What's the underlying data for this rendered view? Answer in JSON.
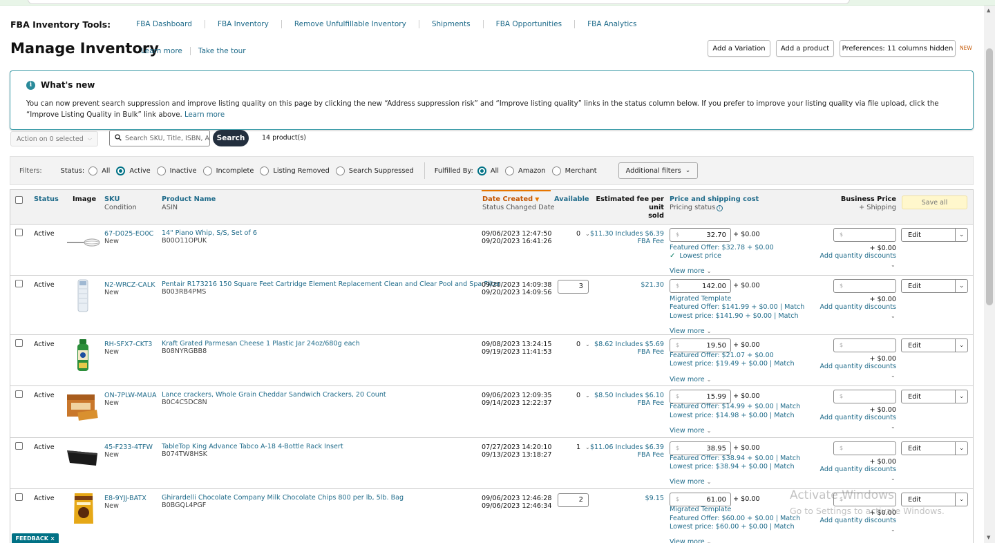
{
  "tools": {
    "label": "FBA Inventory Tools:",
    "links": [
      "FBA Dashboard",
      "FBA Inventory",
      "Remove Unfulfillable Inventory",
      "Shipments",
      "FBA Opportunities",
      "FBA Analytics"
    ]
  },
  "page": {
    "title": "Manage Inventory",
    "learn_more": "Learn more",
    "take_tour": "Take the tour",
    "add_variation": "Add a Variation",
    "add_product": "Add a product",
    "preferences": "Preferences: 11 columns hidden",
    "new_tag": "NEW"
  },
  "whats_new": {
    "title": "What's new",
    "body": "You can now prevent search suppression and improve listing quality on this page by clicking the new “Address suppression risk” and “Improve listing quality” links in the status column below. If you prefer to improve your listing quality via file upload, click the “Improve Listing Quality in Bulk” link above.",
    "learn_more": "Learn more"
  },
  "toolbar": {
    "action_select": "Action on 0 selected",
    "search_placeholder": "Search SKU, Title, ISBN, A",
    "search_button": "Search",
    "product_count": "14 product(s)"
  },
  "filters": {
    "label": "Filters:",
    "status_label": "Status:",
    "status_options": [
      "All",
      "Active",
      "Inactive",
      "Incomplete",
      "Listing Removed",
      "Search Suppressed"
    ],
    "status_selected": "Active",
    "fulfilled_label": "Fulfilled By:",
    "fulfilled_options": [
      "All",
      "Amazon",
      "Merchant"
    ],
    "fulfilled_selected": "All",
    "additional": "Additional filters"
  },
  "table": {
    "headers": {
      "status": "Status",
      "image": "Image",
      "sku": "SKU",
      "sku_sub": "Condition",
      "product": "Product Name",
      "product_sub": "ASIN",
      "date": "Date Created",
      "date_sub": "Status Changed Date",
      "available": "Available",
      "fee": "Estimated fee per unit",
      "fee_sub": "sold",
      "price": "Price and shipping cost",
      "price_sub": "Pricing status",
      "business": "Business Price",
      "business_sub": "+ Shipping",
      "save_all": "Save all"
    },
    "common": {
      "plus_zero": "+ $0.00",
      "view_more": "View more",
      "add_qty": "Add quantity discounts",
      "edit": "Edit",
      "dollar": "$"
    },
    "rows": [
      {
        "status": "Active",
        "sku": "67-D025-EO0C",
        "condition": "New",
        "name": "14\" Piano Whip, S/S, Set of 6",
        "asin": "B00O11OPUK",
        "created": "09/06/2023 12:47:50",
        "changed": "09/20/2023 16:41:26",
        "available": "0",
        "fee1": "$11.30 Includes $6.39",
        "fee2": "FBA Fee",
        "price": "32.70",
        "line1": "Featured Offer: $32.78 + $0.00",
        "line2": "Lowest price",
        "line3": ""
      },
      {
        "status": "Active",
        "sku": "N2-WRCZ-CALK",
        "condition": "New",
        "name": "Pentair R173216 150 Square Feet Cartridge Element Replacement Clean and Clear Pool and Spa Filter",
        "asin": "B003RB4PMS",
        "created": "09/20/2023 14:09:38",
        "changed": "09/20/2023 14:09:56",
        "available": "3",
        "fee1": "$21.30",
        "fee2": "",
        "price": "142.00",
        "line1": "Migrated Template",
        "line2": "Featured Offer: $141.99 + $0.00 | Match",
        "line3": "Lowest price: $141.90 + $0.00 | Match"
      },
      {
        "status": "Active",
        "sku": "RH-SFX7-CKT3",
        "condition": "New",
        "name": "Kraft Grated Parmesan Cheese 1 Plastic Jar 24oz/680g each",
        "asin": "B08NYRGBB8",
        "created": "09/08/2023 13:24:15",
        "changed": "09/19/2023 11:41:53",
        "available": "0",
        "fee1": "$8.62 Includes $5.69",
        "fee2": "FBA Fee",
        "price": "19.50",
        "line1": "Featured Offer: $21.07 + $0.00",
        "line2": "Lowest price: $19.49 + $0.00 | Match",
        "line3": ""
      },
      {
        "status": "Active",
        "sku": "ON-7PLW-MAUA",
        "condition": "New",
        "name": "Lance crackers, Whole Grain Cheddar Sandwich Crackers, 20 Count",
        "asin": "B0C4C5DC8N",
        "created": "09/06/2023 12:09:35",
        "changed": "09/14/2023 12:22:37",
        "available": "0",
        "fee1": "$8.50 Includes $6.10",
        "fee2": "FBA Fee",
        "price": "15.99",
        "line1": "Featured Offer: $14.99 + $0.00 | Match",
        "line2": "Lowest price: $14.98 + $0.00 | Match",
        "line3": ""
      },
      {
        "status": "Active",
        "sku": "45-F233-4TFW",
        "condition": "New",
        "name": "TableTop King Advance Tabco A-18 4-Bottle Rack Insert",
        "asin": "B074TW8HSK",
        "created": "07/27/2023 14:20:10",
        "changed": "09/13/2023 13:18:27",
        "available": "1",
        "fee1": "$11.06 Includes $6.39",
        "fee2": "FBA Fee",
        "price": "38.95",
        "line1": "Featured Offer: $38.94 + $0.00 | Match",
        "line2": "Lowest price: $38.94 + $0.00 | Match",
        "line3": ""
      },
      {
        "status": "Active",
        "sku": "E8-9YJJ-BATX",
        "condition": "New",
        "name": "Ghirardelli Chocolate Company Milk Chocolate Chips 800 per lb, 5lb. Bag",
        "asin": "B0BGQL4PGF",
        "created": "09/06/2023 12:46:28",
        "changed": "09/06/2023 12:46:34",
        "available": "2",
        "fee1": "$9.15",
        "fee2": "",
        "price": "61.00",
        "line1": "Migrated Template",
        "line2": "Featured Offer: $60.00 + $0.00 | Match",
        "line3": "Lowest price: $60.00 + $0.00 | Match"
      }
    ]
  },
  "feedback": "FEEDBACK",
  "watermark": {
    "line1": "Activate Windows",
    "line2": "Go to Settings to activate Windows."
  },
  "colors": {
    "teal_link": "#1f6b8a",
    "accent": "#007185",
    "orange": "#c45500",
    "dark_button": "#232f3e"
  }
}
